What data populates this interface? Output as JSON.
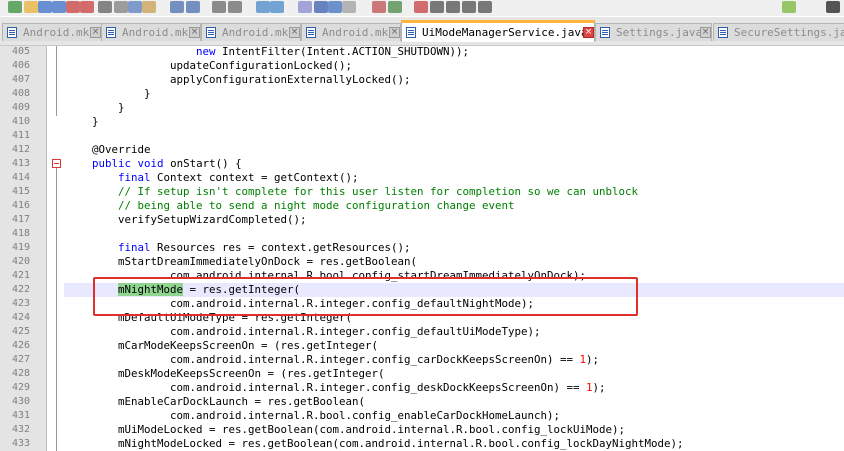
{
  "toolbar": {
    "icons": [
      "new-file-icon",
      "open-folder-icon",
      "save-icon",
      "save-all-icon",
      "close-icon",
      "close-all-icon",
      "print-icon",
      "cut-icon",
      "copy-icon",
      "paste-icon",
      "undo-icon",
      "redo-icon",
      "find-icon",
      "replace-icon",
      "zoom-in-icon",
      "zoom-out-icon",
      "sync-scroll-icon",
      "word-wrap-icon",
      "show-all-chars-icon",
      "indent-guide-icon",
      "language-icon",
      "folder-as-workspace-icon",
      "record-macro-icon",
      "stop-macro-icon",
      "play-macro-icon",
      "run-macro-icon",
      "save-macro-icon",
      "android-icon",
      "console-icon"
    ]
  },
  "tabs": [
    {
      "label": "Android.mk",
      "active": false
    },
    {
      "label": "Android.mk",
      "active": false
    },
    {
      "label": "Android.mk",
      "active": false
    },
    {
      "label": "Android.mk",
      "active": false
    },
    {
      "label": "UiModeManagerService.java",
      "active": true
    },
    {
      "label": "Settings.java",
      "active": false
    },
    {
      "label": "SecureSettings.java",
      "active": false
    }
  ],
  "lines": [
    {
      "num": "405",
      "code": "                    new IntentFilter(Intent.ACTION_SHUTDOWN));"
    },
    {
      "num": "406",
      "code": "                updateConfigurationLocked();"
    },
    {
      "num": "407",
      "code": "                applyConfigurationExternallyLocked();"
    },
    {
      "num": "408",
      "code": "            }"
    },
    {
      "num": "409",
      "code": "        }"
    },
    {
      "num": "410",
      "code": "    }"
    },
    {
      "num": "411",
      "code": ""
    },
    {
      "num": "412",
      "code": "    @Override"
    },
    {
      "num": "413",
      "code": "    public void onStart() {"
    },
    {
      "num": "414",
      "code": "        final Context context = getContext();"
    },
    {
      "num": "415",
      "code": "        // If setup isn't complete for this user listen for completion so we can unblock"
    },
    {
      "num": "416",
      "code": "        // being able to send a night mode configuration change event"
    },
    {
      "num": "417",
      "code": "        verifySetupWizardCompleted();"
    },
    {
      "num": "418",
      "code": ""
    },
    {
      "num": "419",
      "code": "        final Resources res = context.getResources();"
    },
    {
      "num": "420",
      "code": "        mStartDreamImmediatelyOnDock = res.getBoolean("
    },
    {
      "num": "421",
      "code": "                com.android.internal.R.bool.config_startDreamImmediatelyOnDock);"
    },
    {
      "num": "422",
      "code": "        mNightMode = res.getInteger("
    },
    {
      "num": "423",
      "code": "                com.android.internal.R.integer.config_defaultNightMode);"
    },
    {
      "num": "424",
      "code": "        mDefaultUiModeType = res.getInteger("
    },
    {
      "num": "425",
      "code": "                com.android.internal.R.integer.config_defaultUiModeType);"
    },
    {
      "num": "426",
      "code": "        mCarModeKeepsScreenOn = (res.getInteger("
    },
    {
      "num": "427",
      "code": "                com.android.internal.R.integer.config_carDockKeepsScreenOn) == 1);"
    },
    {
      "num": "428",
      "code": "        mDeskModeKeepsScreenOn = (res.getInteger("
    },
    {
      "num": "429",
      "code": "                com.android.internal.R.integer.config_deskDockKeepsScreenOn) == 1);"
    },
    {
      "num": "430",
      "code": "        mEnableCarDockLaunch = res.getBoolean("
    },
    {
      "num": "431",
      "code": "                com.android.internal.R.bool.config_enableCarDockHomeLaunch);"
    },
    {
      "num": "432",
      "code": "        mUiModeLocked = res.getBoolean(com.android.internal.R.bool.config_lockUiMode);"
    },
    {
      "num": "433",
      "code": "        mNightModeLocked = res.getBoolean(com.android.internal.R.bool.config_lockDayNightMode);"
    }
  ],
  "current_line": "422",
  "selected_text": "mNightMode",
  "colors": {
    "keyword": "#0000ff",
    "comment": "#008000",
    "number": "#ff0000",
    "selection": "#8fd48f",
    "current_line": "#e8e8ff",
    "annotation_box": "#e0302c",
    "active_tab_accent": "#ffb43c"
  }
}
